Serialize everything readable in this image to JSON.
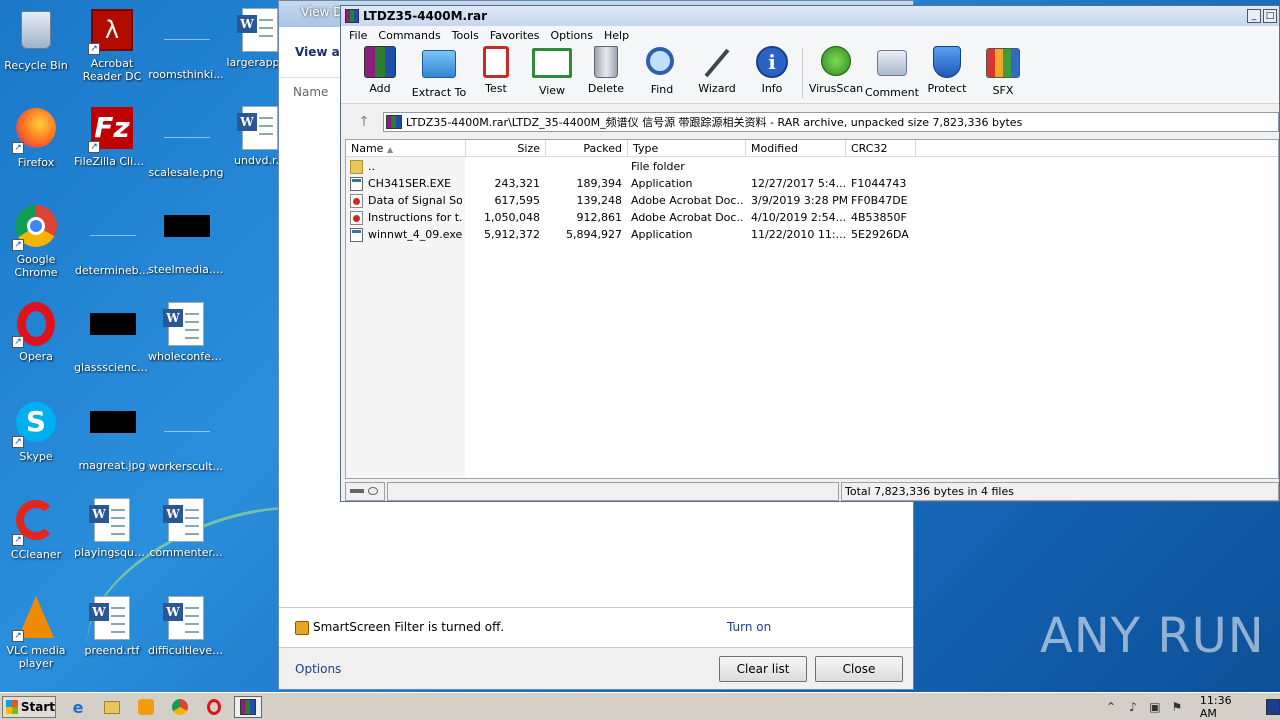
{
  "desktop": {
    "icons": [
      {
        "label": "Recycle Bin"
      },
      {
        "label": "Acrobat Reader DC"
      },
      {
        "label": "roomsthinki..."
      },
      {
        "label": "largerappr..."
      },
      {
        "label": "Firefox"
      },
      {
        "label": "FileZilla Client"
      },
      {
        "label": "scalesale.png"
      },
      {
        "label": "undvd.r..."
      },
      {
        "label": "Google Chrome"
      },
      {
        "label": "determineb..."
      },
      {
        "label": "steelmedia.jpg"
      },
      {
        "label": "Opera"
      },
      {
        "label": "glassscience..."
      },
      {
        "label": "wholeconfer..."
      },
      {
        "label": "Skype"
      },
      {
        "label": "magreat.jpg"
      },
      {
        "label": "workerscult..."
      },
      {
        "label": "CCleaner"
      },
      {
        "label": "playingsqua..."
      },
      {
        "label": "commenter..."
      },
      {
        "label": "VLC media player"
      },
      {
        "label": "preend.rtf"
      },
      {
        "label": "difficultlevel..."
      }
    ]
  },
  "ie_window": {
    "title": "View D",
    "view_anchor": "View an",
    "name_header": "Name",
    "smartscreen_text": "SmartScreen Filter is turned off.",
    "turn_on": "Turn on",
    "options": "Options",
    "clear_list": "Clear list",
    "close": "Close"
  },
  "winrar": {
    "title": "LTDZ35-4400M.rar",
    "menu": [
      "File",
      "Commands",
      "Tools",
      "Favorites",
      "Options",
      "Help"
    ],
    "toolbar": [
      {
        "label": "Add",
        "icon": "add-icon"
      },
      {
        "label": "Extract To",
        "icon": "extract-to-icon"
      },
      {
        "label": "Test",
        "icon": "test-icon"
      },
      {
        "label": "View",
        "icon": "view-icon"
      },
      {
        "label": "Delete",
        "icon": "delete-icon"
      },
      {
        "label": "Find",
        "icon": "find-icon"
      },
      {
        "label": "Wizard",
        "icon": "wizard-icon"
      },
      {
        "label": "Info",
        "icon": "info-icon"
      },
      {
        "label": "VirusScan",
        "icon": "virusscan-icon"
      },
      {
        "label": "Comment",
        "icon": "comment-icon"
      },
      {
        "label": "Protect",
        "icon": "protect-icon"
      },
      {
        "label": "SFX",
        "icon": "sfx-icon"
      }
    ],
    "path": "LTDZ35-4400M.rar\\LTDZ_35-4400M_频谱仪 信号源 带跟踪源相关资料 - RAR archive, unpacked size 7,823,336 bytes",
    "columns": [
      "Name",
      "Size",
      "Packed",
      "Type",
      "Modified",
      "CRC32"
    ],
    "rows": [
      {
        "name": "..",
        "size": "",
        "packed": "",
        "type": "File folder",
        "modified": "",
        "crc": "",
        "kind": "folder"
      },
      {
        "name": "CH341SER.EXE",
        "size": "243,321",
        "packed": "189,394",
        "type": "Application",
        "modified": "12/27/2017 5:4...",
        "crc": "F1044743",
        "kind": "exe"
      },
      {
        "name": "Data of Signal So...",
        "size": "617,595",
        "packed": "139,248",
        "type": "Adobe Acrobat Doc...",
        "modified": "3/9/2019 3:28 PM",
        "crc": "FF0B47DE",
        "kind": "pdf"
      },
      {
        "name": "Instructions for t...",
        "size": "1,050,048",
        "packed": "912,861",
        "type": "Adobe Acrobat Doc...",
        "modified": "4/10/2019 2:54...",
        "crc": "4B53850F",
        "kind": "pdf"
      },
      {
        "name": "winnwt_4_09.exe",
        "size": "5,912,372",
        "packed": "5,894,927",
        "type": "Application",
        "modified": "11/22/2010 11:...",
        "crc": "5E2926DA",
        "kind": "exe"
      }
    ],
    "status": "Total 7,823,336 bytes in 4 files"
  },
  "taskbar": {
    "start": "Start",
    "clock": "11:36 AM"
  },
  "watermark": "ANY RUN"
}
